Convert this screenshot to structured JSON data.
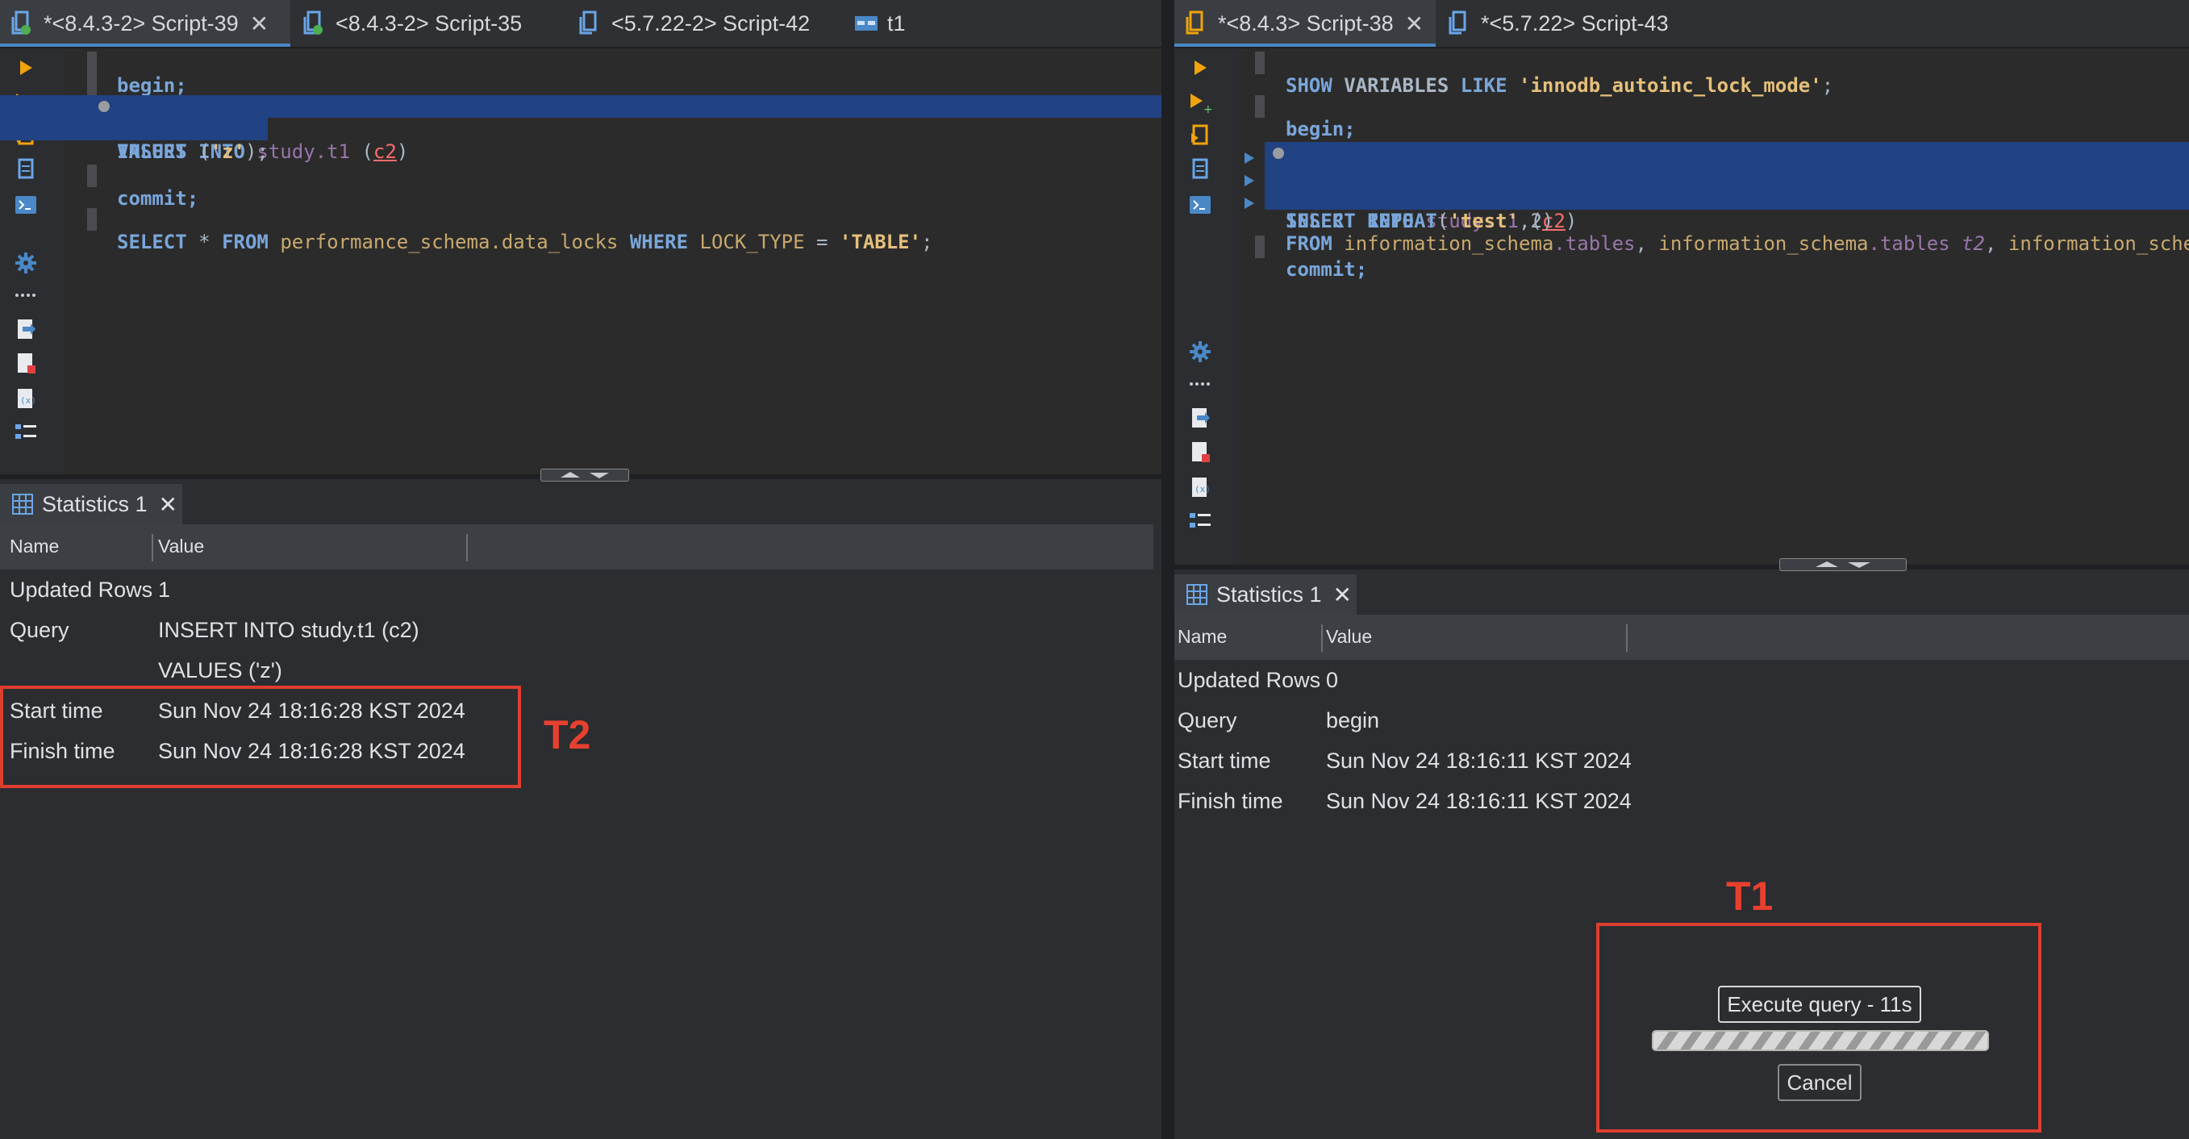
{
  "left": {
    "tabs": [
      {
        "label": "*<8.4.3-2> Script-39",
        "icon": "sql-script-icon",
        "active": true,
        "close": "✕"
      },
      {
        "label": "<8.4.3-2> Script-35",
        "icon": "sql-script-icon",
        "active": false
      },
      {
        "label": "<5.7.22-2> Script-42",
        "icon": "sql-script-icon",
        "active": false
      },
      {
        "label": "t1",
        "icon": "table-icon",
        "active": false
      }
    ],
    "code": {
      "begin": "begin;",
      "insert_kw": "INSERT INTO",
      "insert_schema": "study",
      "insert_table": ".t1",
      "insert_open": " (",
      "insert_col": "c2",
      "insert_close": ")",
      "values_kw": "VALUES",
      "values_val": "'z'",
      "values_rest": ");",
      "values_open": " (",
      "commit": "commit;",
      "select_kw": "SELECT",
      "select_star": " * ",
      "from_kw": "FROM",
      "select_src": "performance_schema",
      "select_src2": ".data_locks",
      "where_kw": "WHERE",
      "lock_type": "LOCK_TYPE",
      "eq": " = ",
      "table_val": "'TABLE'",
      "semi": ";"
    },
    "results": {
      "tab_label": "Statistics 1",
      "col_name": "Name",
      "col_value": "Value",
      "rows": [
        {
          "name": "Updated Rows",
          "value": "1"
        },
        {
          "name": "Query",
          "value": "INSERT INTO study.t1 (c2)"
        },
        {
          "name": "",
          "value": "VALUES ('z')"
        },
        {
          "name": "Start time",
          "value": "Sun Nov 24 18:16:28 KST 2024"
        },
        {
          "name": "Finish time",
          "value": "Sun Nov 24 18:16:28 KST 2024"
        }
      ]
    },
    "annotation": "T2"
  },
  "right": {
    "tabs": [
      {
        "label": "*<8.4.3> Script-38",
        "icon": "sql-script-icon",
        "active": true,
        "close": "✕"
      },
      {
        "label": "*<5.7.22> Script-43",
        "icon": "sql-script-icon",
        "active": false
      }
    ],
    "code": {
      "show_kw": "SHOW",
      "variables_kw": "VARIABLES",
      "like_kw": "LIKE",
      "show_val": "'innodb_autoinc_lock_mode'",
      "semi": ";",
      "begin": "begin;",
      "insert_kw": "INSERT INTO",
      "insert_schema": "study",
      "insert_table": ".t1",
      "insert_open": " (",
      "insert_col": "c2",
      "insert_close": ")",
      "select_kw": "SELECT",
      "repeat_kw": "REPEAT",
      "repeat_open": "(",
      "repeat_val": "'test'",
      "repeat_rest": ",2)",
      "from_kw": "FROM",
      "from_1": "information_schema",
      "from_1b": ".tables",
      "comma": ", ",
      "from_2": "information_schema",
      "from_2b": ".tables",
      "alias": " t2",
      "from_3": "information_sche",
      "commit": "commit;"
    },
    "results": {
      "tab_label": "Statistics 1",
      "col_name": "Name",
      "col_value": "Value",
      "rows": [
        {
          "name": "Updated Rows",
          "value": "0"
        },
        {
          "name": "Query",
          "value": "begin"
        },
        {
          "name": "Start time",
          "value": "Sun Nov 24 18:16:11 KST 2024"
        },
        {
          "name": "Finish time",
          "value": "Sun Nov 24 18:16:11 KST 2024"
        }
      ]
    },
    "progress": {
      "title": "Execute query - 11s",
      "cancel": "Cancel"
    },
    "annotation": "T1"
  },
  "colors": {
    "accent": "#4a88c7",
    "selection": "#214283",
    "annotation": "#e03e2f"
  }
}
